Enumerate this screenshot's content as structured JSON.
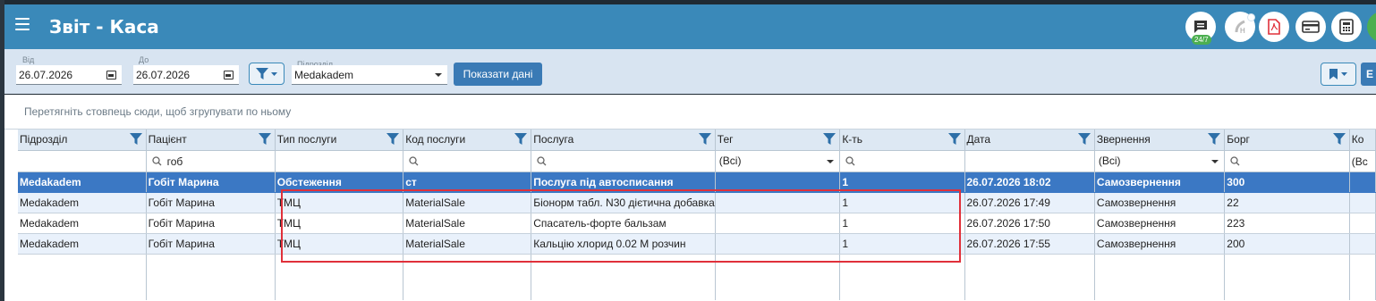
{
  "header": {
    "title": "Звіт - Каса",
    "support_badge": "24/7",
    "icons": [
      "chat-icon",
      "help-icon",
      "pdf-icon",
      "card-icon",
      "calculator-icon"
    ],
    "accent": "#3a89b9"
  },
  "toolbar": {
    "from_label": "Від",
    "from_value": "26.07.2026",
    "to_label": "До",
    "to_value": "26.07.2026",
    "division_label": "Підрозділ",
    "division_value": "Medakadem",
    "show_button": "Показати дані",
    "cut_button": "Е"
  },
  "grid": {
    "group_panel_hint": "Перетягніть стовпець сюди, щоб згрупувати по ньому",
    "columns": [
      "Підрозділ",
      "Пацієнт",
      "Тип послуги",
      "Код послуги",
      "Послуга",
      "Тег",
      "К-ть",
      "Дата",
      "Звернення",
      "Борг",
      "Ко"
    ],
    "filters": {
      "patient": "гоб",
      "tag": "(Всі)",
      "appeal": "(Всі)",
      "last": "(Вс"
    },
    "rows": [
      {
        "division": "Medakadem",
        "patient": "Гобіт Марина",
        "service_type": "Обстеження",
        "service_code": "ст",
        "service": "Послуга під автосписання",
        "tag": "",
        "qty": "1",
        "date": "26.07.2026 18:02",
        "appeal": "Самозвернення",
        "debt": "300",
        "last": ""
      },
      {
        "division": "Medakadem",
        "patient": "Гобіт Марина",
        "service_type": "ТМЦ",
        "service_code": "MaterialSale",
        "service": "Біонорм табл. N30 дієтична добавка",
        "tag": "",
        "qty": "1",
        "date": "26.07.2026 17:49",
        "appeal": "Самозвернення",
        "debt": "22",
        "last": ""
      },
      {
        "division": "Medakadem",
        "patient": "Гобіт Марина",
        "service_type": "ТМЦ",
        "service_code": "MaterialSale",
        "service": "Спасатель-форте бальзам",
        "tag": "",
        "qty": "1",
        "date": "26.07.2026 17:50",
        "appeal": "Самозвернення",
        "debt": "223",
        "last": ""
      },
      {
        "division": "Medakadem",
        "patient": "Гобіт Марина",
        "service_type": "ТМЦ",
        "service_code": "MaterialSale",
        "service": "Кальцію хлорид 0.02 М розчин",
        "tag": "",
        "qty": "1",
        "date": "26.07.2026 17:55",
        "appeal": "Самозвернення",
        "debt": "200",
        "last": ""
      }
    ],
    "selected_row_color": "#3b78c4",
    "highlight_color": "#e0303a"
  }
}
